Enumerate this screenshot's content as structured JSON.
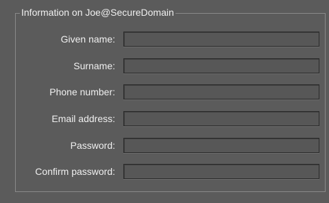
{
  "group": {
    "title": "Information on Joe@SecureDomain"
  },
  "fields": [
    {
      "label": "Given name:",
      "value": ""
    },
    {
      "label": "Surname:",
      "value": ""
    },
    {
      "label": "Phone number:",
      "value": ""
    },
    {
      "label": "Email address:",
      "value": ""
    },
    {
      "label": "Password:",
      "value": ""
    },
    {
      "label": "Confirm password:",
      "value": ""
    }
  ]
}
